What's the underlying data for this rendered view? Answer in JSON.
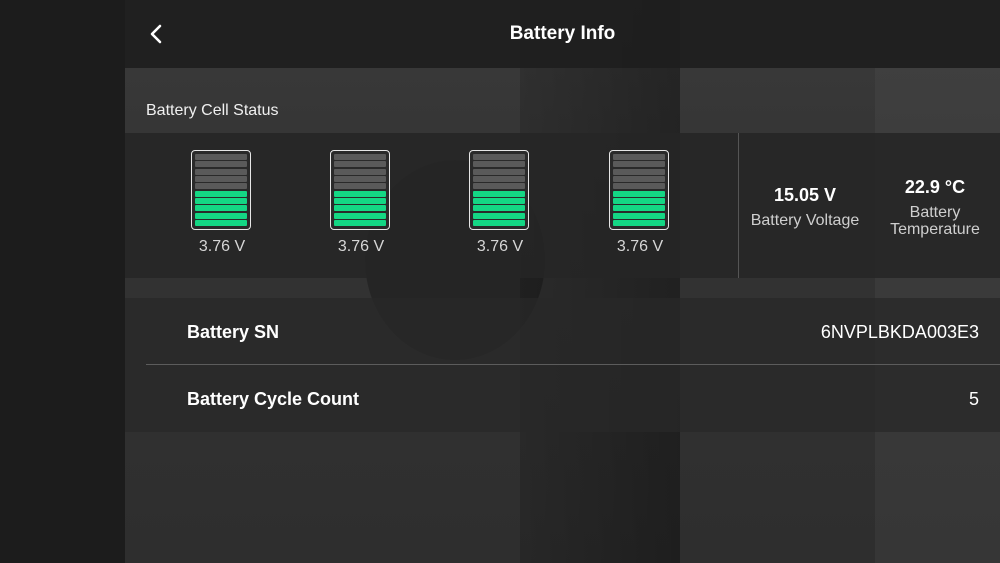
{
  "header": {
    "title": "Battery Info",
    "back_icon": "chevron-left-icon"
  },
  "cell_status": {
    "label": "Battery Cell Status",
    "cells": [
      {
        "voltage": "3.76 V",
        "level": 0.5
      },
      {
        "voltage": "3.76 V",
        "level": 0.5
      },
      {
        "voltage": "3.76 V",
        "level": 0.5
      },
      {
        "voltage": "3.76 V",
        "level": 0.5
      }
    ],
    "fill_color": "#14d784"
  },
  "stats": {
    "voltage_value": "15.05 V",
    "voltage_label": "Battery Voltage",
    "temperature_value": "22.9 °C",
    "temperature_label_line1": "Battery",
    "temperature_label_line2": "Temperature"
  },
  "info": {
    "rows": [
      {
        "label": "Battery SN",
        "value": "6NVPLBKDA003E3"
      },
      {
        "label": "Battery Cycle Count",
        "value": "5"
      }
    ]
  }
}
